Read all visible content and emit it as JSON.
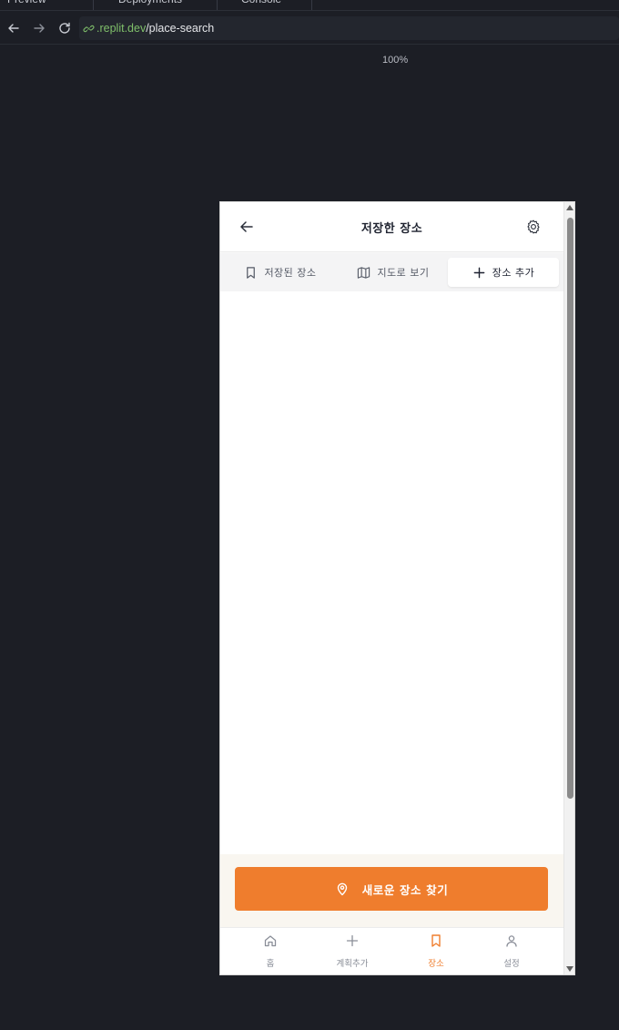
{
  "browser": {
    "tabs": [
      {
        "label": "Preview"
      },
      {
        "label": "Deployments"
      },
      {
        "label": "Console"
      }
    ],
    "url_host": ".replit.dev",
    "url_path": "/place-search",
    "zoom": "100%"
  },
  "app": {
    "header": {
      "title": "저장한 장소"
    },
    "tabs": [
      {
        "label": "저장된 장소",
        "icon": "bookmark-icon"
      },
      {
        "label": "지도로 보기",
        "icon": "map-icon"
      },
      {
        "label": "장소 추가",
        "icon": "plus-icon"
      }
    ],
    "active_tab": 2,
    "cta": {
      "label": "새로운 장소 찾기",
      "icon": "map-pin-icon"
    },
    "bottom_nav": [
      {
        "label": "홈",
        "icon": "home-icon"
      },
      {
        "label": "계획추가",
        "icon": "plus-icon"
      },
      {
        "label": "장소",
        "icon": "bookmark-icon"
      },
      {
        "label": "설정",
        "icon": "user-icon"
      }
    ],
    "active_nav": 2,
    "colors": {
      "accent": "#ef7d2d",
      "page_background": "#1c1e25",
      "footer_background": "#f9f6f0"
    }
  }
}
